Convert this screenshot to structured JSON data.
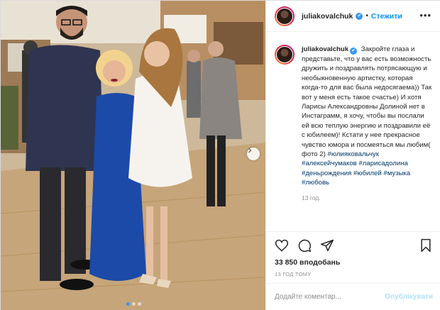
{
  "post": {
    "username": "juliakovalchuk",
    "verified_glyph": "✔",
    "separator": "•",
    "follow_label": "Стежити",
    "more_glyph": "•••"
  },
  "caption": {
    "username": "juliakovalchuk",
    "text": "Закройте глаза и представьте, что у вас есть возможность дружить и поздравлять потрясающую и необыкновенную артистку, которая когда-то для вас была недосягаема)) Так вот у меня есть такое счастье) И хотя Ларисы Александровны Долиной нет в Инстаграмм, я хочу, чтобы вы послали ей всю теплую энергию и поздравили её с юбилеем)! Кстати у нее прекрасное чувство юмора и посмеяться мы любим( фото 2)",
    "hashtags": [
      "#юлияковальчук",
      "#алексейчумаков",
      "#ларисадолина",
      "#деньрождения",
      "#юбилей",
      "#музыка",
      "#любовь"
    ],
    "time": "13 год."
  },
  "stats": {
    "likes": "33 850 вподобань",
    "time_ago": "13 ГОД ТОМУ"
  },
  "comment": {
    "placeholder": "Додайте коментар...",
    "publish_label": "Опублікувати"
  },
  "carousel": {
    "slides_total": 3,
    "active_slide": 1
  },
  "icons": [
    "heart-icon",
    "comment-icon",
    "share-icon",
    "bookmark-icon",
    "chevron-right-icon"
  ],
  "colors": {
    "accent": "#0095f6",
    "verified": "#3897f0",
    "hashtag": "#00376b",
    "muted": "#8e8e8e",
    "publish_disabled": "#b2dffc"
  }
}
